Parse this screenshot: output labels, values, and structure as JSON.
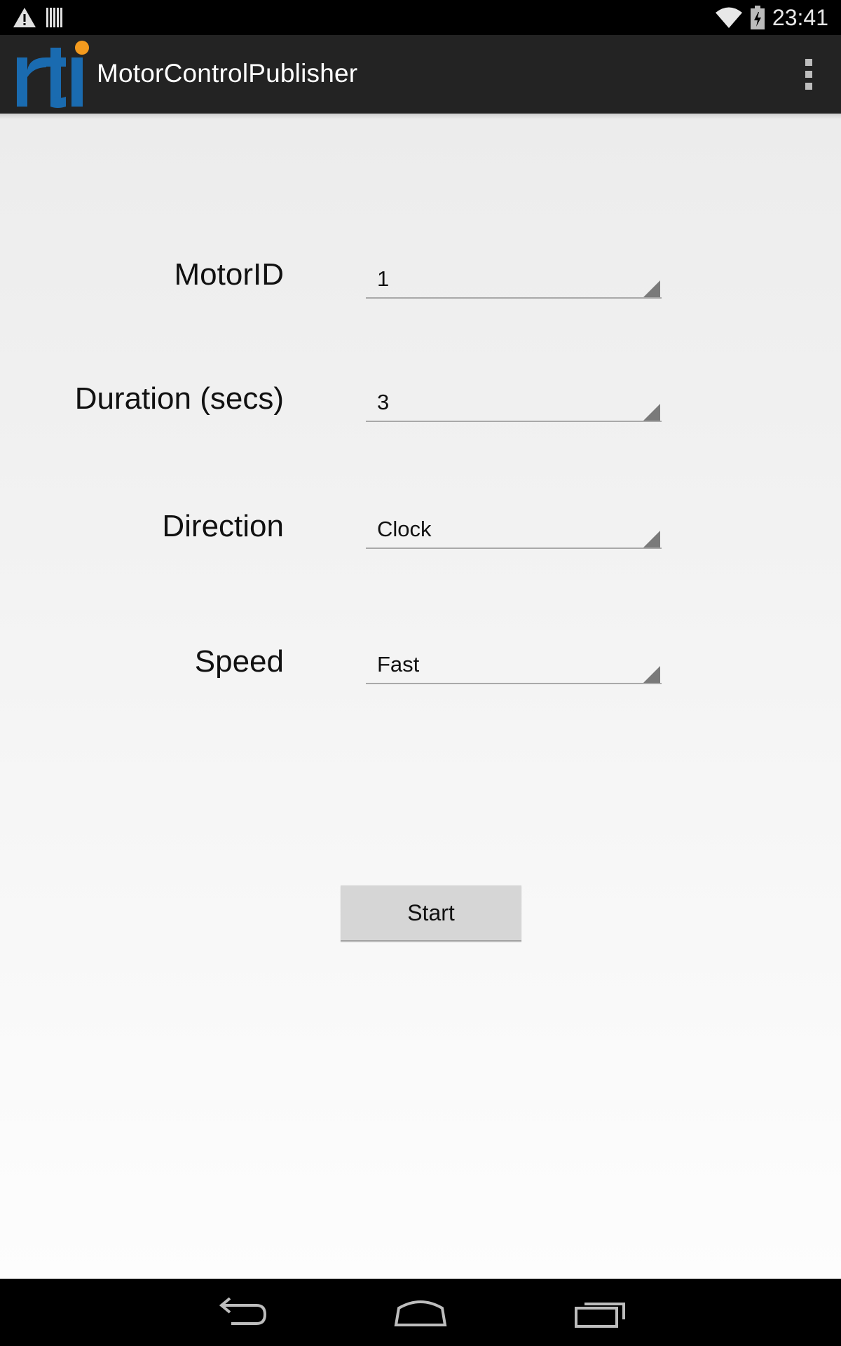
{
  "status_bar": {
    "time": "23:41",
    "icons": [
      "warning-icon",
      "barcode-icon",
      "wifi-icon",
      "battery-charging-icon"
    ]
  },
  "action_bar": {
    "title": "MotorControlPublisher",
    "logo_text": "rti",
    "overflow_icon": "overflow-menu-icon"
  },
  "form": {
    "motor_id": {
      "label": "MotorID",
      "value": "1"
    },
    "duration": {
      "label": "Duration (secs)",
      "value": "3"
    },
    "direction": {
      "label": "Direction",
      "value": "Clock"
    },
    "speed": {
      "label": "Speed",
      "value": "Fast"
    }
  },
  "start_button": {
    "label": "Start"
  },
  "nav_bar": {
    "icons": [
      "back-icon",
      "home-icon",
      "recent-apps-icon"
    ]
  },
  "colors": {
    "logo_blue": "#1a6bb0",
    "logo_orange": "#f39a1e",
    "action_bar": "#232323"
  }
}
